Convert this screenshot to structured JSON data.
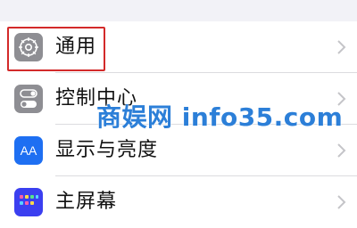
{
  "settings_list": {
    "items": [
      {
        "label": "通用",
        "icon": "gear-icon",
        "icon_bg": "#8e8e93"
      },
      {
        "label": "控制中心",
        "icon": "toggle-icon",
        "icon_bg": "#8e8e93"
      },
      {
        "label": "显示与亮度",
        "icon": "aa-icon",
        "icon_bg": "#1e6ff2",
        "icon_text": "AA"
      },
      {
        "label": "主屏幕",
        "icon": "home-screen-icon",
        "icon_bg": "#3b3ff0"
      }
    ]
  },
  "watermark": {
    "text": "商娱网 info35.com",
    "color": "#2c7fd8"
  },
  "highlight": {
    "color": "#d32a2a",
    "target": "通用"
  }
}
